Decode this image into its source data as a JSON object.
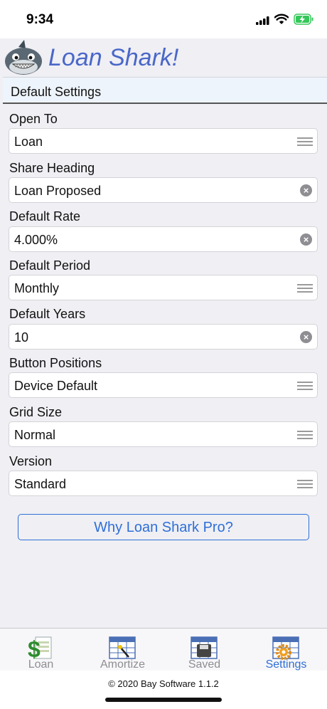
{
  "status": {
    "time": "9:34"
  },
  "app": {
    "title": "Loan Shark!"
  },
  "section": {
    "title": "Default Settings"
  },
  "fields": [
    {
      "label": "Open To",
      "value": "Loan",
      "control": "picker"
    },
    {
      "label": "Share Heading",
      "value": "Loan Proposed",
      "control": "clear"
    },
    {
      "label": "Default Rate",
      "value": "4.000%",
      "control": "clear"
    },
    {
      "label": "Default Period",
      "value": "Monthly",
      "control": "picker"
    },
    {
      "label": "Default Years",
      "value": "10",
      "control": "clear"
    },
    {
      "label": "Button Positions",
      "value": "Device Default",
      "control": "picker"
    },
    {
      "label": "Grid Size",
      "value": "Normal",
      "control": "picker"
    },
    {
      "label": "Version",
      "value": "Standard",
      "control": "picker"
    }
  ],
  "why_button": "Why Loan Shark Pro?",
  "tabs": [
    {
      "label": "Loan",
      "icon": "dollar-sheet-icon"
    },
    {
      "label": "Amortize",
      "icon": "grid-wand-icon"
    },
    {
      "label": "Saved",
      "icon": "saved-grid-icon"
    },
    {
      "label": "Settings",
      "icon": "gear-grid-icon",
      "active": true
    }
  ],
  "footer": {
    "copyright": "© 2020 Bay Software 1.1.2"
  },
  "colors": {
    "accent": "#2f6fd6",
    "title": "#4a67c8"
  }
}
